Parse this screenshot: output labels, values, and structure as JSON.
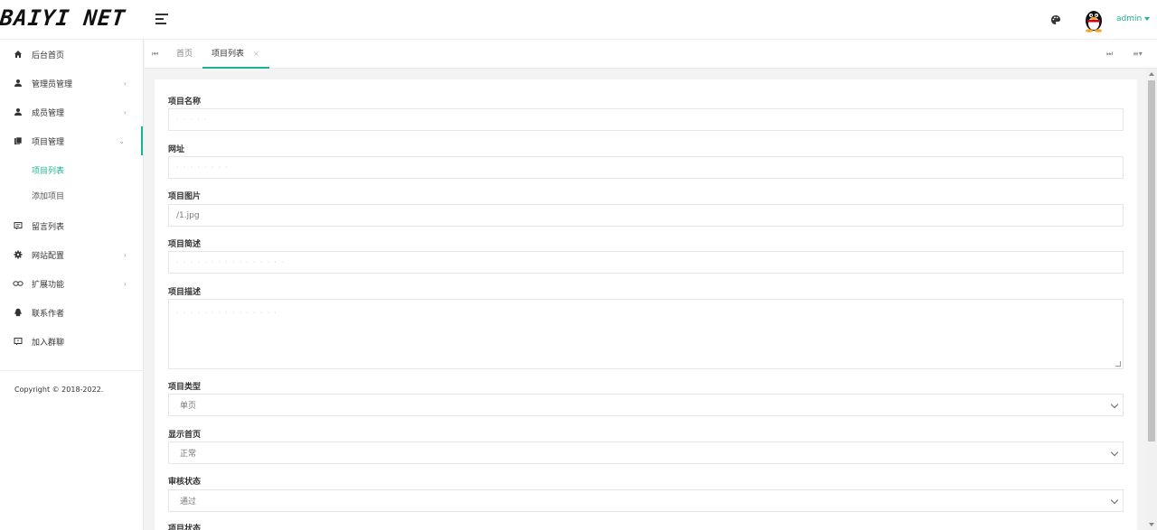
{
  "header": {
    "logo_text": "BAIYI NET",
    "user_name": "admin",
    "icons": [
      "menu-icon",
      "palette-icon",
      "qq-penguin-avatar"
    ]
  },
  "sidebar": {
    "items": [
      {
        "label": "后台首页",
        "icon": "home-icon"
      },
      {
        "label": "管理员管理",
        "icon": "user-icon",
        "arrow": "›"
      },
      {
        "label": "成员管理",
        "icon": "user-icon",
        "arrow": "›"
      },
      {
        "label": "项目管理",
        "icon": "book-icon",
        "arrow": "⌄"
      },
      {
        "label": "留言列表",
        "icon": "message-icon"
      },
      {
        "label": "网站配置",
        "icon": "gear-icon",
        "arrow": "›"
      },
      {
        "label": "扩展功能",
        "icon": "link-icon",
        "arrow": "›"
      },
      {
        "label": "联系作者",
        "icon": "qq-icon"
      },
      {
        "label": "加入群聊",
        "icon": "chat-icon"
      }
    ],
    "sub_items": [
      {
        "label": "项目列表"
      },
      {
        "label": "添加项目"
      }
    ],
    "copyright": "Copyright © 2018-2022."
  },
  "tabs": {
    "home": "首页",
    "current": "项目列表",
    "close": "×",
    "prev_icon": "⏮",
    "next_icon": "⏭",
    "menu_icon": "≡▾"
  },
  "form": {
    "name_label": "项目名称",
    "name_value": "· · · · ·",
    "url_label": "网址",
    "url_value": "· · · · · · · ·",
    "image_label": "项目图片",
    "image_value": "/1.jpg",
    "brief_label": "项目简述",
    "brief_value": "· · · · · · · · · · · · · · · ·",
    "desc_label": "项目描述",
    "desc_value": "· · · · · · · · · · · · · · ·",
    "type_label": "项目类型",
    "type_value": "单页",
    "home_label": "显示首页",
    "home_value": "正常",
    "review_label": "审核状态",
    "review_value": "通过",
    "status_label": "项目状态"
  }
}
